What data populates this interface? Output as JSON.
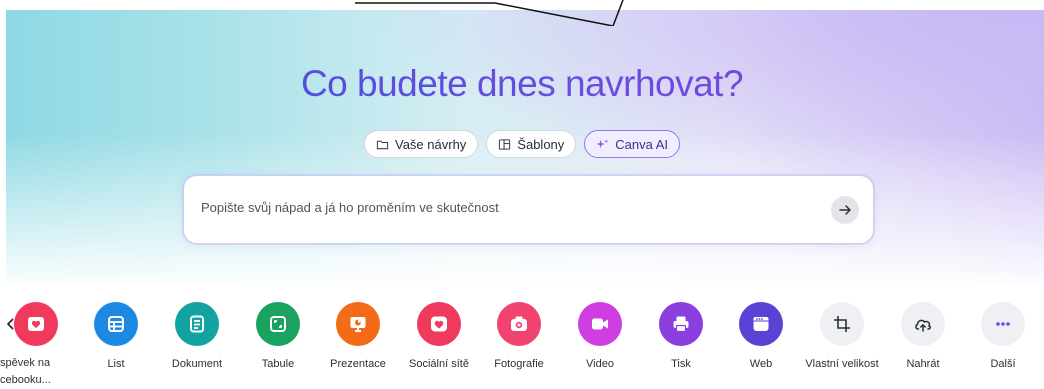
{
  "page": {
    "title": "Co budete dnes navrhovat?"
  },
  "tabs": [
    {
      "label": "Vaše návrhy",
      "icon": "folder-icon"
    },
    {
      "label": "Šablony",
      "icon": "template-icon"
    },
    {
      "label": "Canva AI",
      "icon": "sparkle-icon"
    }
  ],
  "prompt": {
    "placeholder": "Popište svůj nápad a já ho proměním ve skutečnost",
    "value": ""
  },
  "categories": [
    {
      "label": "List",
      "icon": "sheet-icon",
      "color": "#1e88e5"
    },
    {
      "label": "Dokument",
      "icon": "document-icon",
      "color": "#13a3a0"
    },
    {
      "label": "Tabule",
      "icon": "whiteboard-icon",
      "color": "#1aa261"
    },
    {
      "label": "Prezentace",
      "icon": "presentation-icon",
      "color": "#f36b16"
    },
    {
      "label": "Sociální sítě",
      "icon": "heart-icon",
      "color": "#ef3a5d"
    },
    {
      "label": "Fotografie",
      "icon": "camera-icon",
      "color": "#f0436f"
    },
    {
      "label": "Video",
      "icon": "video-icon",
      "color": "#cf3ee0"
    },
    {
      "label": "Tisk",
      "icon": "print-icon",
      "color": "#8b3fde"
    },
    {
      "label": "Web",
      "icon": "web-icon",
      "color": "#5b42d6"
    },
    {
      "label": "Vlastní velikost",
      "icon": "crop-icon",
      "color": "#eef0f3"
    },
    {
      "label": "Nahrát",
      "icon": "upload-cloud-icon",
      "color": "#eef0f3"
    },
    {
      "label": "Další",
      "icon": "more-icon",
      "color": "#eef0f3"
    }
  ],
  "partial_category": {
    "label_line1": "spěvek na",
    "label_line2": "cebooku...",
    "color": "#ef3a5d"
  }
}
